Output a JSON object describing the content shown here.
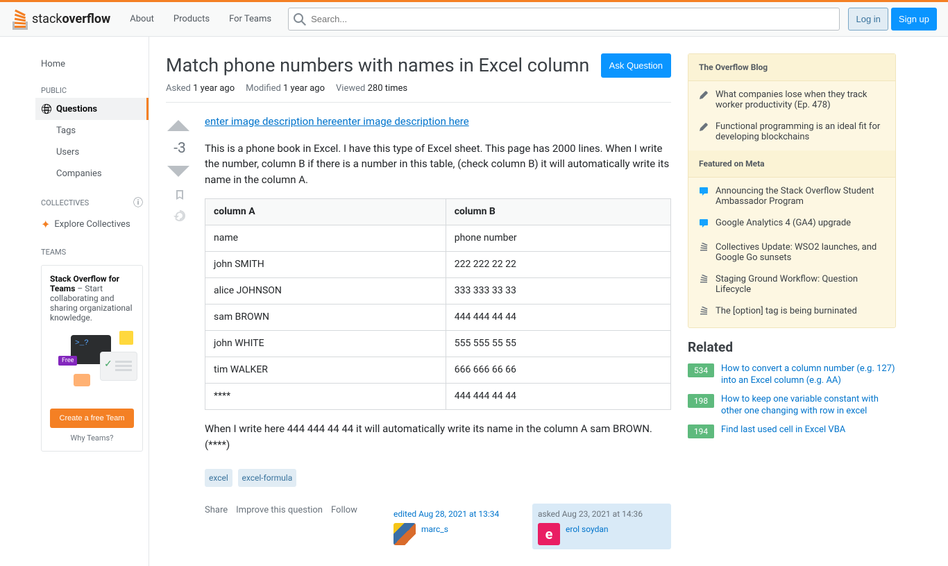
{
  "topbar": {
    "logo_text_thin": "stack",
    "logo_text_bold": "overflow",
    "nav": {
      "about": "About",
      "products": "Products",
      "teams": "For Teams"
    },
    "search_placeholder": "Search...",
    "login": "Log in",
    "signup": "Sign up"
  },
  "leftnav": {
    "home": "Home",
    "public": "PUBLIC",
    "questions": "Questions",
    "tags": "Tags",
    "users": "Users",
    "companies": "Companies",
    "collectives": "COLLECTIVES",
    "explore_collectives": "Explore Collectives",
    "teams": "TEAMS"
  },
  "teamsbox": {
    "title": "Stack Overflow for Teams",
    "desc": " – Start collaborating and sharing organizational knowledge.",
    "free": "Free",
    "cta": "Create a free Team",
    "why": "Why Teams?"
  },
  "question": {
    "title": "Match phone numbers with names in Excel column",
    "ask": "Ask Question",
    "meta_asked_label": "Asked",
    "meta_asked": "1 year ago",
    "meta_modified_label": "Modified",
    "meta_modified": "1 year ago",
    "meta_viewed_label": "Viewed",
    "meta_viewed": "280 times",
    "score": "-3",
    "link1": "enter image description here",
    "link2": "enter image description here",
    "body_p1": "This is a phone book in Excel. I have this type of Excel sheet. This page has 2000 lines. When I write the number, column B if there is a number in this table, (check column B) it will automatically write its name in the column A.",
    "body_p2": "When I write here 444 444 44 44 it will automatically write its name in the column A sam BROWN. (****)",
    "table": {
      "headers": [
        "column A",
        "column B"
      ],
      "rows": [
        [
          "name",
          "phone number"
        ],
        [
          "john SMITH",
          "222 222 22 22"
        ],
        [
          "alice JOHNSON",
          "333 333 33 33"
        ],
        [
          "sam BROWN",
          "444 444 44 44"
        ],
        [
          "john WHITE",
          "555 555 55 55"
        ],
        [
          "tim WALKER",
          "666 666 66 66"
        ],
        [
          "****",
          "444 444 44 44"
        ]
      ]
    },
    "tags": [
      "excel",
      "excel-formula"
    ],
    "actions": {
      "share": "Share",
      "improve": "Improve this question",
      "follow": "Follow"
    },
    "edited": {
      "time": "edited Aug 28, 2021 at 13:34",
      "user": "marc_s",
      "rep": ""
    },
    "asked": {
      "time": "asked Aug 23, 2021 at 14:36",
      "user": "erol soydan",
      "avatar_letter": "e",
      "rep": ""
    }
  },
  "sidebar": {
    "blog_title": "The Overflow Blog",
    "blog": [
      "What companies lose when they track worker productivity (Ep. 478)",
      "Functional programming is an ideal fit for developing blockchains"
    ],
    "meta_title": "Featured on Meta",
    "meta": [
      "Announcing the Stack Overflow Student Ambassador Program",
      "Google Analytics 4 (GA4) upgrade",
      "Collectives Update: WSO2 launches, and Google Go sunsets",
      "Staging Ground Workflow: Question Lifecycle",
      "The [option] tag is being burninated"
    ],
    "related_title": "Related",
    "related": [
      {
        "score": "534",
        "title": "How to convert a column number (e.g. 127) into an Excel column (e.g. AA)"
      },
      {
        "score": "198",
        "title": "How to keep one variable constant with other one changing with row in excel"
      },
      {
        "score": "194",
        "title": "Find last used cell in Excel VBA"
      }
    ]
  }
}
